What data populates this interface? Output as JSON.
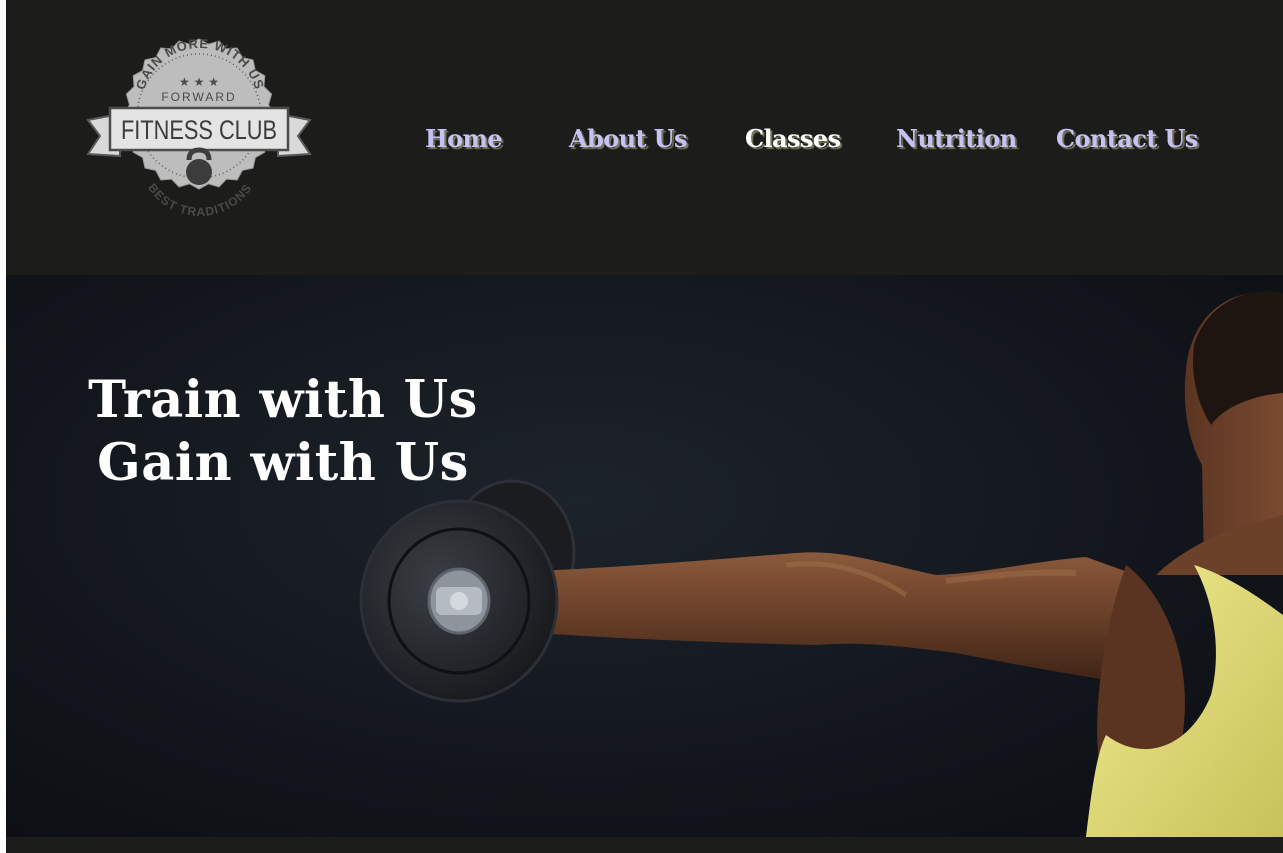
{
  "logo": {
    "arc_top": "GAIN MORE WITH US",
    "subtitle": "FORWARD",
    "name": "FITNESS CLUB",
    "arc_bottom": "BEST TRADITIONS"
  },
  "nav": {
    "items": [
      {
        "label": "Home",
        "active": false
      },
      {
        "label": "About Us",
        "active": false
      },
      {
        "label": "Classes",
        "active": true
      },
      {
        "label": "Nutrition",
        "active": false
      },
      {
        "label": "Contact Us",
        "active": false
      }
    ]
  },
  "hero": {
    "line1": "Train with Us",
    "line2": "Gain with Us"
  },
  "colors": {
    "background": "#1c1c1b",
    "nav_link": "#c5c3f5",
    "nav_active": "#ffffff",
    "hero_text": "#ffffff",
    "shirt": "#e8e27a"
  },
  "icons": {
    "logo_badge": "kettlebell-badge-icon"
  }
}
